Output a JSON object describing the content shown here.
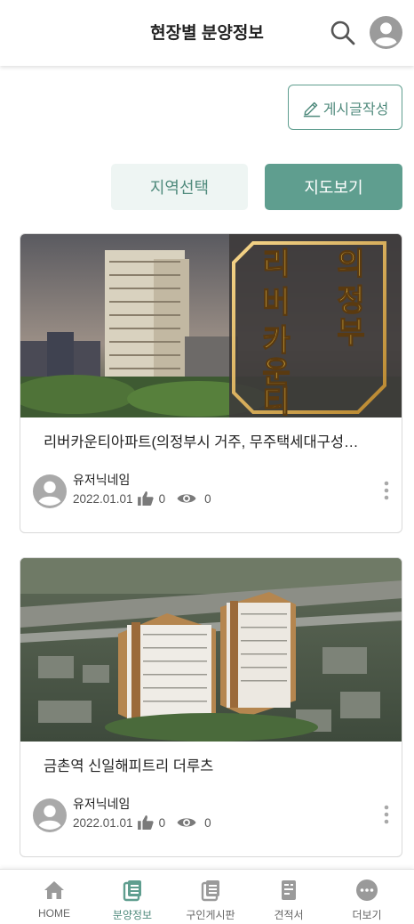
{
  "header": {
    "title": "현장별 분양정보",
    "search_icon": "search-icon",
    "profile_icon": "avatar-icon"
  },
  "actions": {
    "write_label": "게시글작성",
    "write_icon": "pencil-icon",
    "region_label": "지역선택",
    "map_label": "지도보기"
  },
  "posts": [
    {
      "title": "리버카운티아파트(의정부시 거주, 무주택세대구성…",
      "image_text": "리버카운티 의정부",
      "author": "유저닉네임",
      "date": "2022.01.01",
      "likes": "0",
      "views": "0"
    },
    {
      "title": "금촌역 신일해피트리 더루츠",
      "author": "유저닉네임",
      "date": "2022.01.01",
      "likes": "0",
      "views": "0"
    }
  ],
  "nav": {
    "active": "분양정보",
    "items": [
      {
        "label": "HOME",
        "icon": "home-icon"
      },
      {
        "label": "분양정보",
        "icon": "document-list-icon"
      },
      {
        "label": "구인게시판",
        "icon": "board-icon"
      },
      {
        "label": "견적서",
        "icon": "estimate-icon"
      },
      {
        "label": "더보기",
        "icon": "more-horizontal-icon"
      }
    ]
  },
  "colors": {
    "accent": "#5f9e8f",
    "accent_light": "#eef5f3",
    "nav_inactive": "#9a9a9a"
  }
}
